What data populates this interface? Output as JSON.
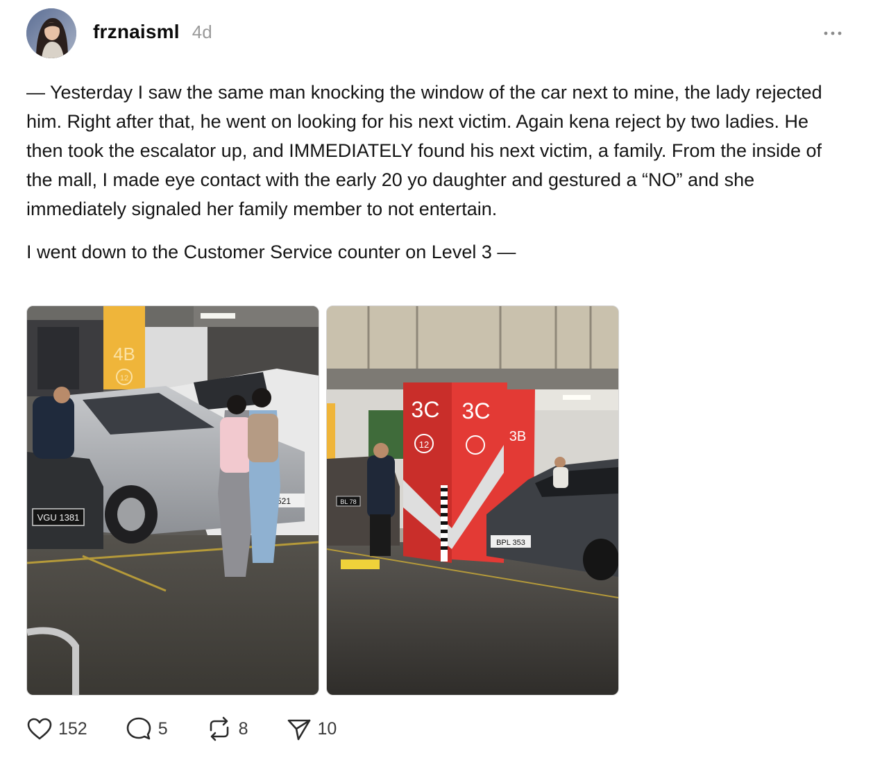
{
  "post": {
    "username": "frznaisml",
    "timestamp": "4d",
    "paragraphs": [
      "— Yesterday I saw the same man knocking the window of the car next to mine, the lady rejected him. Right after that, he went on looking for his next victim. Again kena reject by two ladies. He then took the escalator up, and IMMEDIATELY found his next victim, a family. From the inside of the mall, I made eye contact with the early 20 yo daughter and gestured a “NO” and she immediately signaled her family member to not entertain.",
      "I went down to the Customer Service counter on Level 3 —"
    ]
  },
  "photos": {
    "photo1": {
      "pillar_label": "4B",
      "pillar_number": "12",
      "plate_left": "VGU 1381",
      "plate_right": "521"
    },
    "photo2": {
      "pillar_label_a": "3C",
      "pillar_label_b": "3C",
      "pillar_label_c": "3B",
      "pillar_number": "12",
      "plate_left": "BL 78",
      "plate_right": "BPL 353"
    }
  },
  "actions": {
    "likes": "152",
    "replies": "5",
    "reposts": "8",
    "shares": "10"
  },
  "icons": {
    "like": "heart-icon",
    "reply": "comment-icon",
    "repost": "repost-icon",
    "share": "send-icon",
    "more": "more-options-icon"
  },
  "colors": {
    "text": "#141414",
    "muted": "#9a9a9a",
    "pillar_red": "#e33a35",
    "pillar_yellow": "#efb53a"
  }
}
